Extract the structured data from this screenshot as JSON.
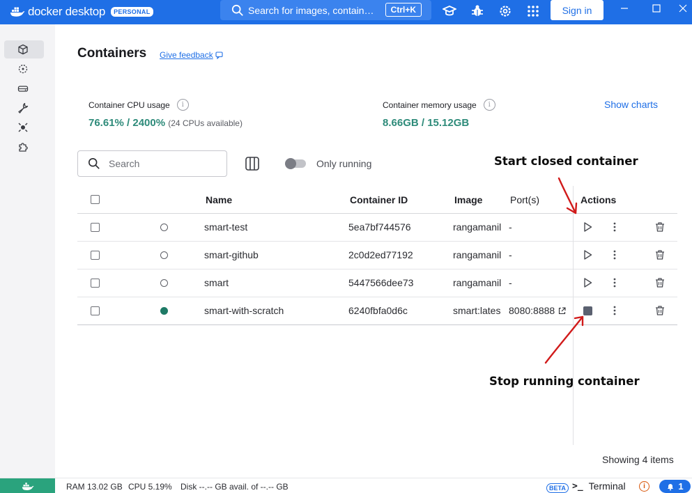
{
  "app": {
    "brand": "docker desktop",
    "plan_badge": "PERSONAL",
    "search_placeholder": "Search for images, contain…",
    "search_shortcut": "Ctrl+K",
    "sign_in": "Sign in",
    "accent": "#1f6fe6"
  },
  "toolbar_icons": [
    "learning-center-icon",
    "troubleshoot-bug-icon",
    "settings-gear-icon",
    "extensions-grid-icon"
  ],
  "sidebar": {
    "items": [
      {
        "name": "containers",
        "icon": "cube-icon",
        "active": true
      },
      {
        "name": "images",
        "icon": "images-icon",
        "active": false
      },
      {
        "name": "volumes",
        "icon": "volume-drive-icon",
        "active": false
      },
      {
        "name": "builds",
        "icon": "wrench-icon",
        "active": false
      },
      {
        "name": "scout",
        "icon": "scout-icon",
        "active": false
      },
      {
        "name": "extensions",
        "icon": "puzzle-icon",
        "active": false
      }
    ]
  },
  "page": {
    "title": "Containers",
    "feedback_link": "Give feedback"
  },
  "metrics": {
    "cpu_label": "Container CPU usage",
    "cpu_value": "76.61% / 2400%",
    "cpu_note": "(24 CPUs available)",
    "memory_label": "Container memory usage",
    "memory_value": "8.66GB / 15.12GB",
    "show_charts": "Show charts"
  },
  "filters": {
    "search_placeholder": "Search",
    "only_running_label": "Only running",
    "only_running": false
  },
  "table": {
    "columns": [
      "Name",
      "Container ID",
      "Image",
      "Port(s)",
      "Actions"
    ],
    "rows": [
      {
        "name": "smart-test",
        "id": "5ea7bf744576",
        "image": "rangamanil",
        "ports": "-",
        "running": false
      },
      {
        "name": "smart-github",
        "id": "2c0d2ed77192",
        "image": "rangamanil",
        "ports": "-",
        "running": false
      },
      {
        "name": "smart",
        "id": "5447566dee73",
        "image": "rangamanil",
        "ports": "-",
        "running": false
      },
      {
        "name": "smart-with-scratch",
        "id": "6240fbfa0d6c",
        "image": "smart:lates",
        "ports": "8080:8888",
        "running": true
      }
    ],
    "showing": "Showing 4 items"
  },
  "annotations": {
    "start": "Start closed container",
    "stop": "Stop running container",
    "arrow_color": "#d11a1a"
  },
  "footer": {
    "ram": "RAM 13.02 GB",
    "cpu": "CPU 5.19%",
    "disk": "Disk --.-- GB avail. of --.-- GB",
    "beta": "BETA",
    "terminal_prompt": ">_",
    "terminal": "Terminal",
    "notifications": "1"
  }
}
